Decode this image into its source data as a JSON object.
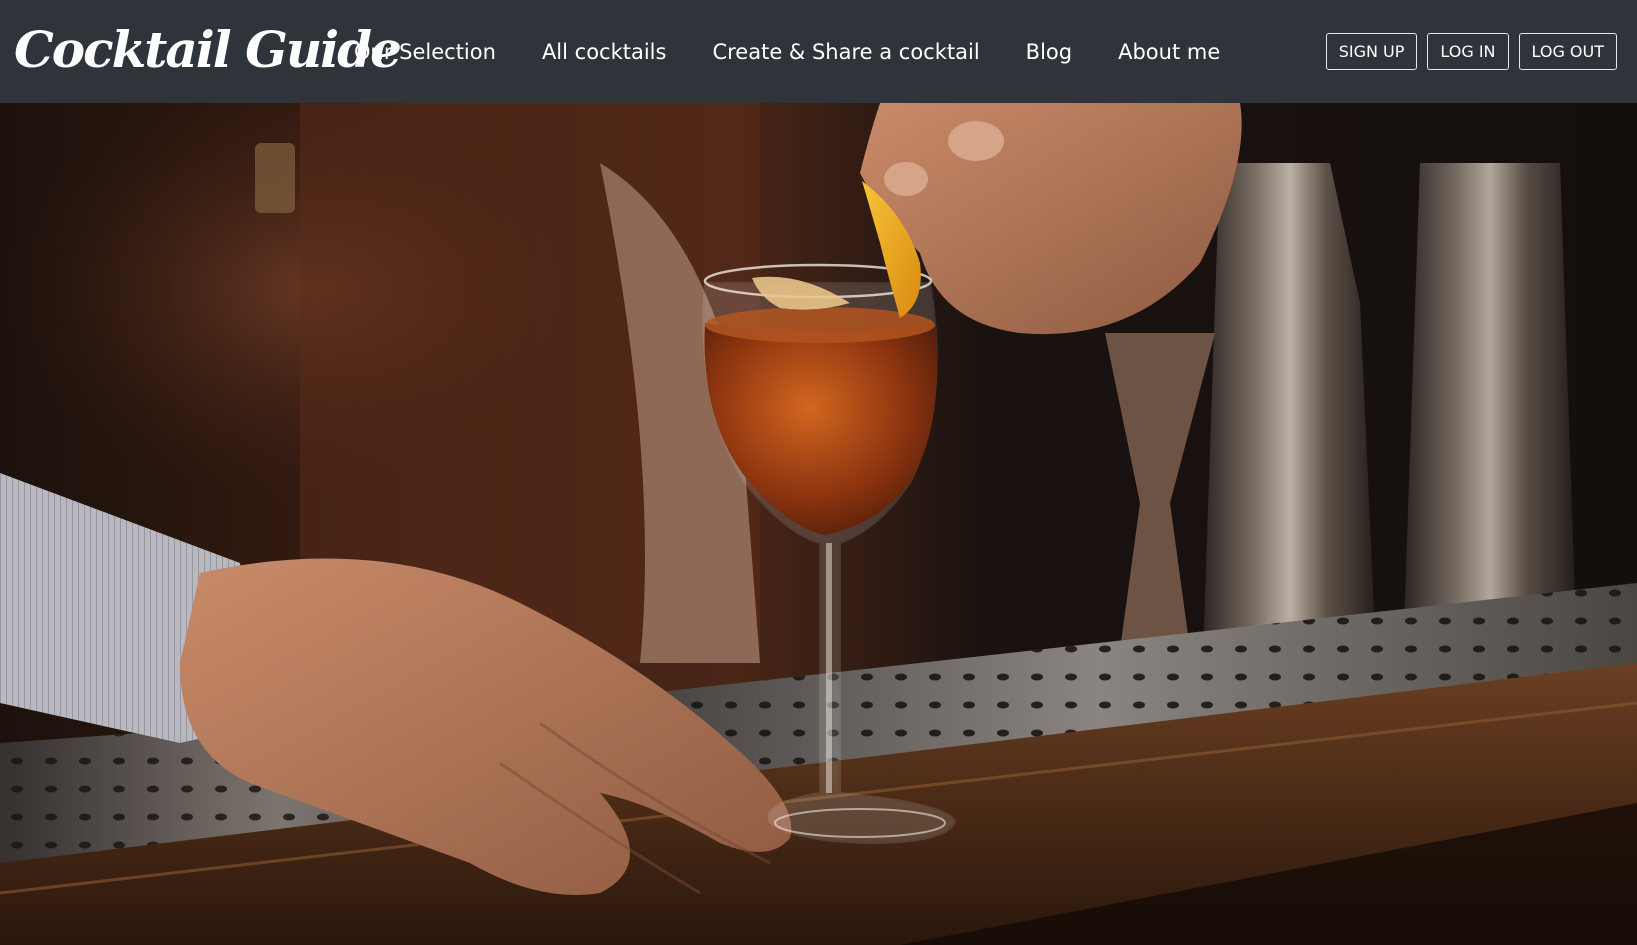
{
  "brand": {
    "logo_text": "Cocktail Guide"
  },
  "nav": {
    "links": [
      {
        "label": "Our Selection"
      },
      {
        "label": "All cocktails"
      },
      {
        "label": "Create & Share a cocktail"
      },
      {
        "label": "Blog"
      },
      {
        "label": "About me"
      }
    ]
  },
  "auth": {
    "sign_up": "SIGN UP",
    "log_in": "LOG IN",
    "log_out": "LOG OUT"
  },
  "colors": {
    "navbar_bg": "#2f343a",
    "nav_text": "#ffffff",
    "button_border": "#e8e8e8"
  },
  "hero": {
    "subject": "bartender garnishing a cocktail glass with an orange peel at a bar counter"
  }
}
